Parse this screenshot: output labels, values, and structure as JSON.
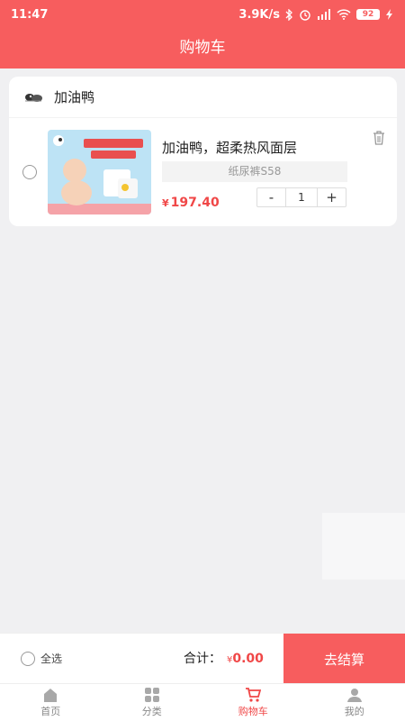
{
  "status_bar": {
    "time": "11:47",
    "speed": "3.9K/s",
    "battery": "92"
  },
  "header": {
    "title": "购物车"
  },
  "cart": {
    "shop": {
      "name": "加油鸭",
      "logo_icon": "duck-logo-icon"
    },
    "items": [
      {
        "title": "加油鸭，超柔热风面层",
        "spec": "纸尿裤S58",
        "currency": "¥",
        "price": "197.40",
        "quantity": "1",
        "decrement_label": "-",
        "increment_label": "+"
      }
    ]
  },
  "bottom_bar": {
    "select_all_label": "全选",
    "total_label": "合计：",
    "total_currency": "¥",
    "total_value": "0.00",
    "checkout_label": "去结算"
  },
  "tabbar": {
    "tabs": [
      {
        "label": "首页",
        "icon": "home-icon"
      },
      {
        "label": "分类",
        "icon": "category-icon"
      },
      {
        "label": "购物车",
        "icon": "cart-icon",
        "active": true
      },
      {
        "label": "我的",
        "icon": "user-icon"
      }
    ]
  },
  "colors": {
    "accent": "#f75d5e",
    "price": "#f04747",
    "background": "#f0f0f2"
  }
}
